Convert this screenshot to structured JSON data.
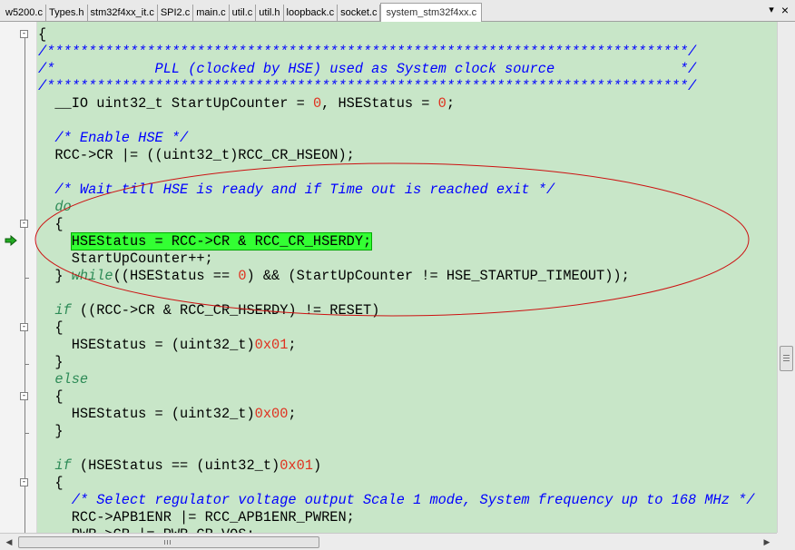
{
  "tabs": [
    {
      "label": "w5200.c",
      "active": false
    },
    {
      "label": "Types.h",
      "active": false
    },
    {
      "label": "stm32f4xx_it.c",
      "active": false
    },
    {
      "label": "SPI2.c",
      "active": false
    },
    {
      "label": "main.c",
      "active": false
    },
    {
      "label": "util.c",
      "active": false
    },
    {
      "label": "util.h",
      "active": false
    },
    {
      "label": "loopback.c",
      "active": false
    },
    {
      "label": "socket.c",
      "active": false
    },
    {
      "label": "system_stm32f4xx.c",
      "active": true
    }
  ],
  "tab_controls": {
    "menu": "▾",
    "close": "×"
  },
  "code_lines": [
    [
      {
        "t": "{"
      }
    ],
    [
      {
        "t": "/*****************************************************************************/",
        "c": "cm"
      }
    ],
    [
      {
        "t": "/*            PLL (clocked by HSE) used as System clock source               */",
        "c": "cm"
      }
    ],
    [
      {
        "t": "/*****************************************************************************/",
        "c": "cm"
      }
    ],
    [
      {
        "t": "  __IO uint32_t StartUpCounter = "
      },
      {
        "t": "0",
        "c": "num"
      },
      {
        "t": ", HSEStatus = "
      },
      {
        "t": "0",
        "c": "num"
      },
      {
        "t": ";"
      }
    ],
    [
      {
        "t": ""
      }
    ],
    [
      {
        "t": "  "
      },
      {
        "t": "/* Enable HSE */",
        "c": "cm"
      }
    ],
    [
      {
        "t": "  RCC->CR |= ((uint32_t)RCC_CR_HSEON);"
      }
    ],
    [
      {
        "t": ""
      }
    ],
    [
      {
        "t": "  "
      },
      {
        "t": "/* Wait till HSE is ready and if Time out is reached exit */",
        "c": "cm"
      }
    ],
    [
      {
        "t": "  "
      },
      {
        "t": "do",
        "c": "kw"
      }
    ],
    [
      {
        "t": "  {"
      }
    ],
    [
      {
        "t": "    "
      },
      {
        "t": "HSEStatus = RCC->CR & RCC_CR_HSERDY;",
        "c": "hl"
      }
    ],
    [
      {
        "t": "    StartUpCounter++;"
      }
    ],
    [
      {
        "t": "  } "
      },
      {
        "t": "while",
        "c": "kw"
      },
      {
        "t": "((HSEStatus == "
      },
      {
        "t": "0",
        "c": "num"
      },
      {
        "t": ") && (StartUpCounter != HSE_STARTUP_TIMEOUT));"
      }
    ],
    [
      {
        "t": ""
      }
    ],
    [
      {
        "t": "  "
      },
      {
        "t": "if",
        "c": "kw"
      },
      {
        "t": " ((RCC->CR & RCC_CR_HSERDY) != RESET)"
      }
    ],
    [
      {
        "t": "  {"
      }
    ],
    [
      {
        "t": "    HSEStatus = (uint32_t)"
      },
      {
        "t": "0x01",
        "c": "num"
      },
      {
        "t": ";"
      }
    ],
    [
      {
        "t": "  }"
      }
    ],
    [
      {
        "t": "  "
      },
      {
        "t": "else",
        "c": "kw"
      }
    ],
    [
      {
        "t": "  {"
      }
    ],
    [
      {
        "t": "    HSEStatus = (uint32_t)"
      },
      {
        "t": "0x00",
        "c": "num"
      },
      {
        "t": ";"
      }
    ],
    [
      {
        "t": "  }"
      }
    ],
    [
      {
        "t": ""
      }
    ],
    [
      {
        "t": "  "
      },
      {
        "t": "if",
        "c": "kw"
      },
      {
        "t": " (HSEStatus == (uint32_t)"
      },
      {
        "t": "0x01",
        "c": "num"
      },
      {
        "t": ")"
      }
    ],
    [
      {
        "t": "  {"
      }
    ],
    [
      {
        "t": "    "
      },
      {
        "t": "/* Select regulator voltage output Scale 1 mode, System frequency up to 168 MHz */",
        "c": "cm"
      }
    ],
    [
      {
        "t": "    RCC->APB1ENR |= RCC_APB1ENR_PWREN;"
      }
    ],
    [
      {
        "t": "    PWR->CR |= PWR_CR_VOS;"
      }
    ]
  ],
  "colors": {
    "editor_bg": "#c8e6c8",
    "comment": "#0000ff",
    "keyword": "#2e8b57",
    "number": "#e0301e",
    "current_line_highlight": "#33ff33",
    "annotation_ellipse": "#cc1111",
    "exec_arrow": "#22aa22"
  },
  "icons": {
    "current_statement": "green-arrow-icon",
    "fold": "fold-minus-icon"
  },
  "scrollbar_glyphs": {
    "left": "◀",
    "right": "▶"
  }
}
